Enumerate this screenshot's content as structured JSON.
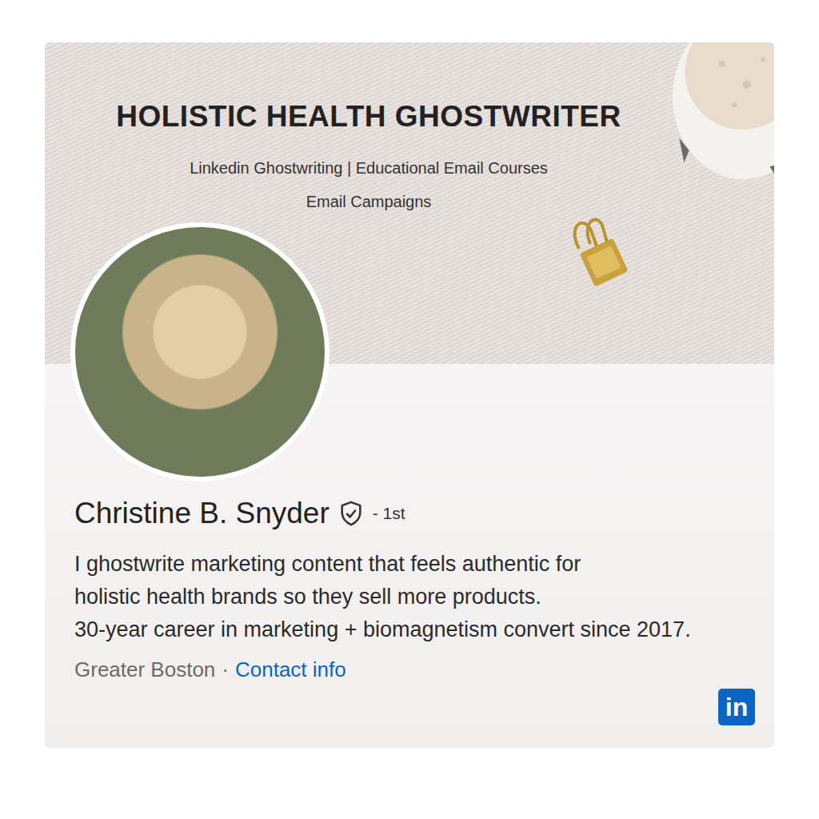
{
  "banner": {
    "title": "HOLISTIC HEALTH GHOSTWRITER",
    "services": [
      "Linkedin Ghostwriting | Educational Email Courses",
      "Email Campaigns"
    ]
  },
  "profile": {
    "name": "Christine B. Snyder",
    "verified": true,
    "degree": "- 1st",
    "headline": [
      "I ghostwrite marketing content that feels authentic for",
      "holistic health brands so they sell more products.",
      "30-year career in marketing + biomagnetism convert since 2017."
    ],
    "location": "Greater Boston",
    "separator": "·",
    "contact_link": "Contact info"
  },
  "brand": {
    "logo": "in"
  }
}
